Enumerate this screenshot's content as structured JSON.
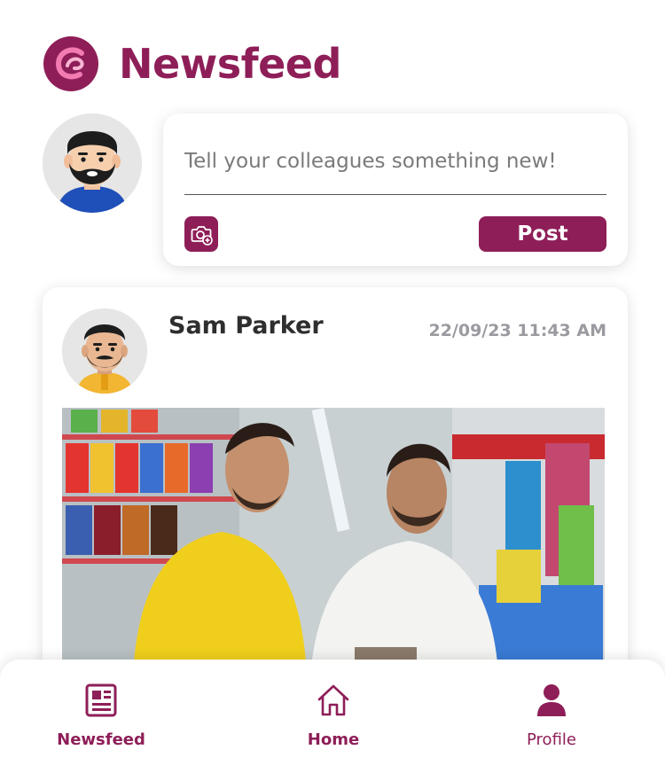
{
  "header": {
    "title": "Newsfeed",
    "logo_icon": "app-logo-icon"
  },
  "composer": {
    "placeholder": "Tell your colleagues something new!",
    "value": "",
    "photo_icon": "camera-add-icon",
    "post_label": "Post"
  },
  "post": {
    "author_name": "Sam Parker",
    "timestamp": "22/09/23 11:43 AM",
    "image_icon": "post-photo"
  },
  "nav": {
    "items": [
      {
        "label": "Newsfeed",
        "icon": "newspaper-icon"
      },
      {
        "label": "Home",
        "icon": "home-icon"
      },
      {
        "label": "Profile",
        "icon": "person-icon"
      }
    ]
  },
  "colors": {
    "brand": "#8e1e58",
    "brand_light": "#e9669d",
    "muted_text": "#9a9aa0"
  }
}
